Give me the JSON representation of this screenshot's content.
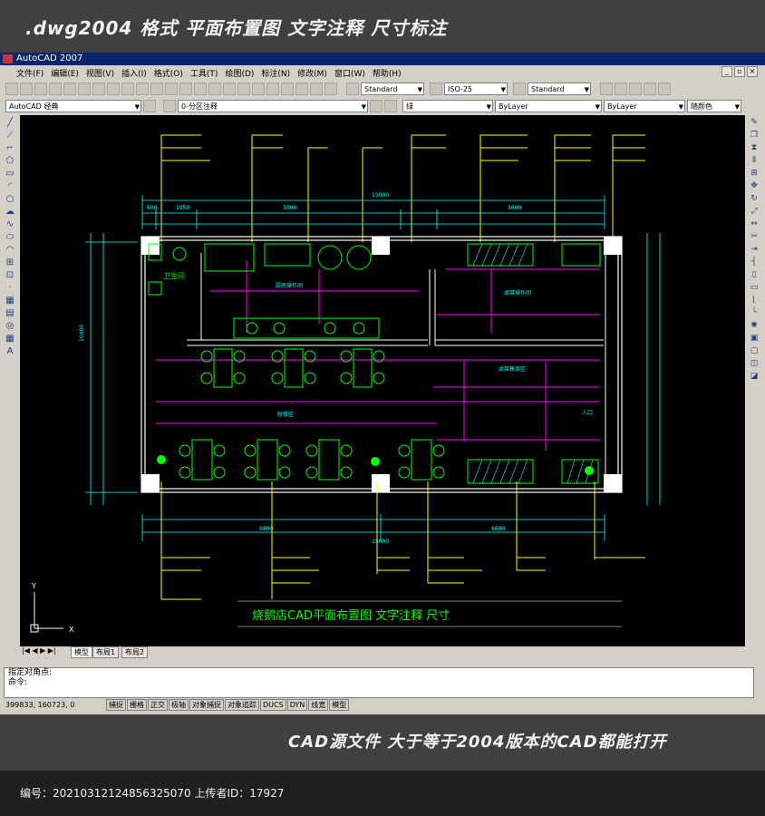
{
  "banner_top": ".dwg2004 格式  平面布置图 文字注释 尺寸标注",
  "window_title": "AutoCAD 2007",
  "menu": [
    "文件(F)",
    "编辑(E)",
    "视图(V)",
    "插入(I)",
    "格式(O)",
    "工具(T)",
    "绘图(D)",
    "标注(N)",
    "修改(M)",
    "窗口(W)",
    "帮助(H)"
  ],
  "toolbar": {
    "text_style": "Standard",
    "dim_style": "ISO-25",
    "table_style": "Standard",
    "workspace": "AutoCAD 经典",
    "layer": "0-分区注释",
    "color": "绿",
    "linetype": "ByLayer",
    "lineweight": "ByLayer",
    "plotstyle": "随颜色"
  },
  "drawing": {
    "title": "烧鹅店CAD平面布置图   文字注释   尺寸",
    "rooms": {
      "restroom": "卫生间",
      "kitchen_left": "厨房操作间",
      "kitchen_right": "卤菜操作间",
      "dining": "就餐区",
      "right_zone": "卤菜售卖区",
      "entrance": "入口"
    },
    "dims": {
      "top_total": "15000",
      "bottom_total": "15000",
      "top_a": "600",
      "top_b": "1050",
      "top_c": "3000",
      "top_d": "3600",
      "bottom_left": "6800",
      "bottom_right": "6600",
      "left_h": "10400"
    },
    "ucs_x": "X",
    "ucs_y": "Y"
  },
  "tabs": [
    "模型",
    "布局1",
    "布局2"
  ],
  "command": {
    "line1": "指定对角点:",
    "line2": "命令:"
  },
  "status": {
    "coords": "399833, 160723, 0",
    "toggles": [
      "捕捉",
      "栅格",
      "正交",
      "极轴",
      "对象捕捉",
      "对象追踪",
      "DUCS",
      "DYN",
      "线宽",
      "模型"
    ]
  },
  "banner_bottom": "CAD源文件  大于等于2004版本的CAD都能打开",
  "footer": "编号：20210312124856325070 上传者ID：17927"
}
